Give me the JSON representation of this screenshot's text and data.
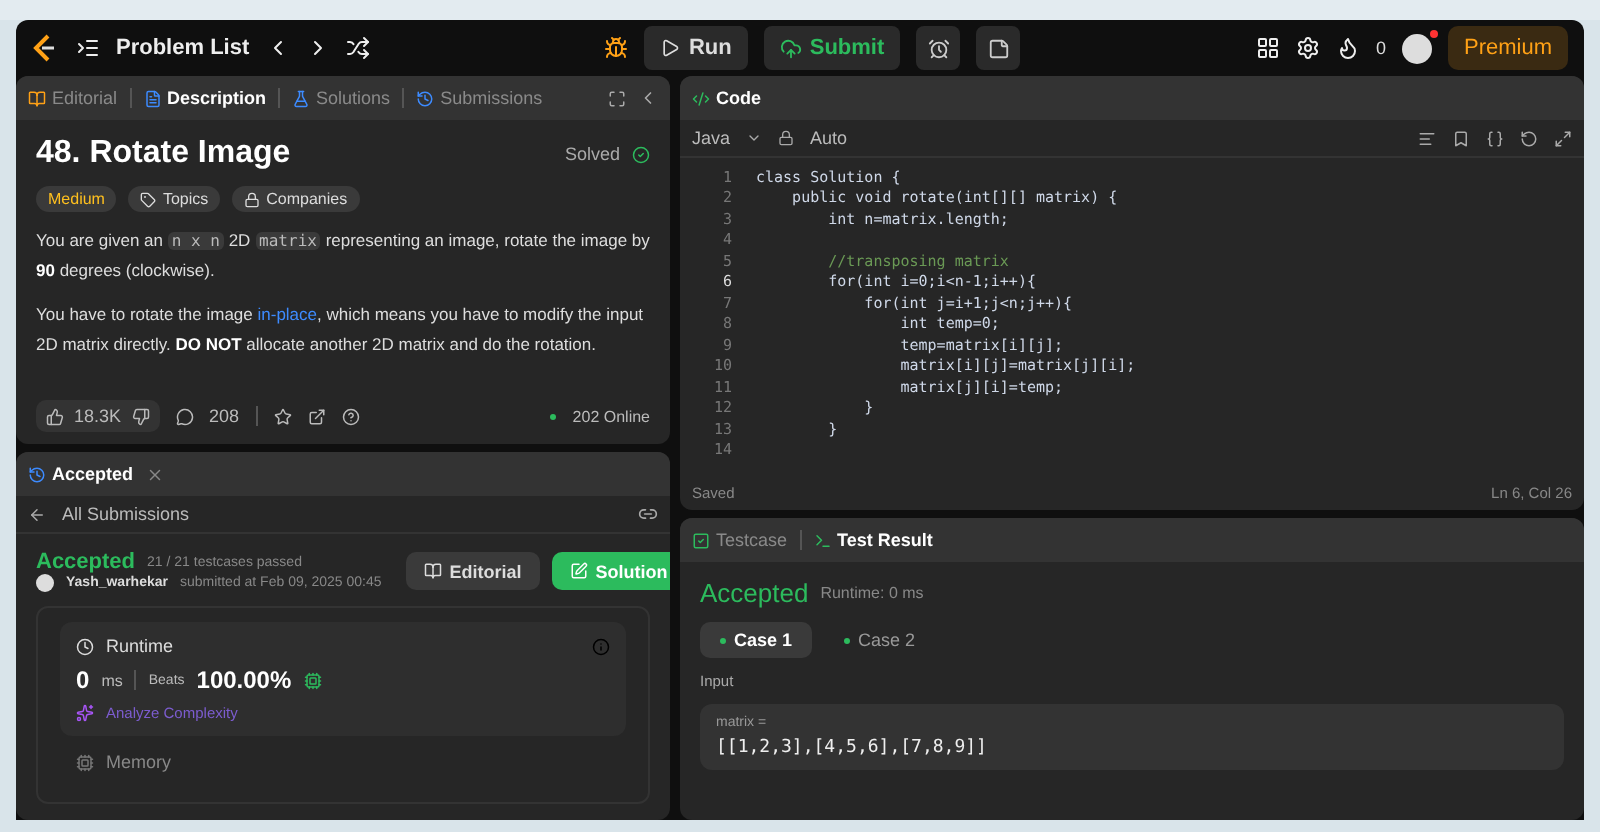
{
  "nav": {
    "problem_list": "Problem List",
    "run": "Run",
    "submit": "Submit",
    "streak": "0",
    "premium": "Premium"
  },
  "description": {
    "tabs": [
      {
        "label": "Editorial",
        "selected": false
      },
      {
        "label": "Description",
        "selected": true
      },
      {
        "label": "Solutions",
        "selected": false
      },
      {
        "label": "Submissions",
        "selected": false
      }
    ],
    "title": "48. Rotate Image",
    "status": "Solved",
    "difficulty": "Medium",
    "tags": [
      "Topics",
      "Companies"
    ],
    "paragraphs": [
      [
        {
          "kind": "text",
          "text": "You are given an "
        },
        {
          "kind": "code",
          "text": "n x n"
        },
        {
          "kind": "text",
          "text": " 2D "
        },
        {
          "kind": "code",
          "text": "matrix"
        },
        {
          "kind": "text",
          "text": " representing an image, rotate the image by **90** degrees (clockwise)."
        }
      ],
      [
        {
          "kind": "text",
          "text": "You have to rotate the image "
        },
        {
          "kind": "link",
          "text": "in-place"
        },
        {
          "kind": "text",
          "text": ", which means you have to modify the input 2D matrix directly. **DO NOT** allocate another 2D matrix and do the rotation."
        }
      ]
    ],
    "likes": "18.3K",
    "comments": "208",
    "online": "202 Online"
  },
  "submission": {
    "tab": "Accepted",
    "back": "All Submissions",
    "verdict": "Accepted",
    "passed": "21 / 21 testcases passed",
    "user": "Yash_warhekar",
    "submitted": "submitted at Feb 09, 2025 00:45",
    "editorial": "Editorial",
    "solution": "Solution",
    "runtime_label": "Runtime",
    "runtime_value": "0",
    "runtime_unit": "ms",
    "beats_label": "Beats",
    "beats_value": "100.00%",
    "analyze": "Analyze Complexity",
    "memory_label": "Memory"
  },
  "code": {
    "tab": "Code",
    "language": "Java",
    "mode": "Auto",
    "lines": [
      {
        "no": "1",
        "text": "class Solution {",
        "kind": "code",
        "current": false
      },
      {
        "no": "2",
        "text": "    public void rotate(int[][] matrix) {",
        "kind": "code",
        "current": false
      },
      {
        "no": "3",
        "text": "        int n=matrix.length;",
        "kind": "code",
        "current": false
      },
      {
        "no": "4",
        "current": false
      },
      {
        "no": "5",
        "text": "        //transposing matrix",
        "kind": "comment",
        "current": false
      },
      {
        "no": "6",
        "text": "        for(int i=0;i<n-1;i++){",
        "kind": "code",
        "current": true
      },
      {
        "no": "7",
        "text": "            for(int j=i+1;j<n;j++){",
        "kind": "code",
        "current": false
      },
      {
        "no": "8",
        "text": "                int temp=0;",
        "kind": "code",
        "current": false
      },
      {
        "no": "9",
        "text": "                temp=matrix[i][j];",
        "kind": "code",
        "current": false
      },
      {
        "no": "10",
        "text": "                matrix[i][j]=matrix[j][i];",
        "kind": "code",
        "current": false
      },
      {
        "no": "11",
        "text": "                matrix[j][i]=temp;",
        "kind": "code",
        "current": false
      },
      {
        "no": "12",
        "text": "            }",
        "kind": "code",
        "current": false
      },
      {
        "no": "13",
        "text": "        }",
        "kind": "code",
        "current": false
      },
      {
        "no": "14",
        "current": false
      }
    ],
    "saved": "Saved",
    "position": "Ln 6, Col 26"
  },
  "testcase": {
    "tabs": [
      {
        "label": "Testcase",
        "selected": false
      },
      {
        "label": "Test Result",
        "selected": true
      }
    ],
    "verdict": "Accepted",
    "runtime": "Runtime: 0 ms",
    "cases": [
      {
        "label": "Case 1",
        "selected": true
      },
      {
        "label": "Case 2",
        "selected": false
      }
    ],
    "input_label": "Input",
    "var_label": "matrix =",
    "var_value": "[[1,2,3],[4,5,6],[7,8,9]]"
  }
}
